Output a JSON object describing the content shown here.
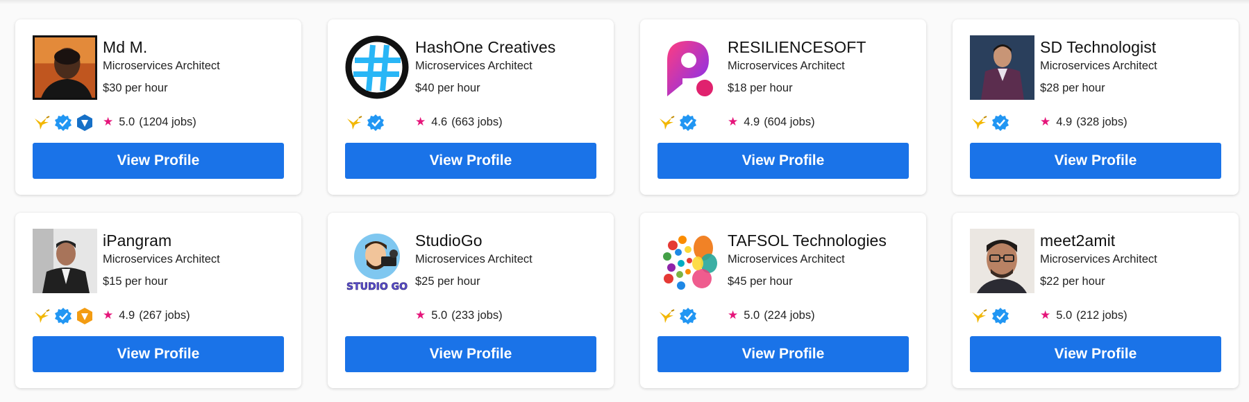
{
  "colors": {
    "accent": "#1a73e8",
    "star": "#e5157a",
    "verified": "#2196f3"
  },
  "cards": [
    {
      "name": "Md M.",
      "role": "Microservices Architect",
      "rate": "$30 per hour",
      "score": "5.0",
      "jobs": "(1204 jobs)",
      "button": "View Profile",
      "badges": [
        "hummingbird-icon",
        "verified-icon",
        "pro-shield-icon"
      ],
      "avatar": "photo-man-dark-shirt"
    },
    {
      "name": "HashOne Creatives",
      "role": "Microservices Architect",
      "rate": "$40 per hour",
      "score": "4.6",
      "jobs": "(663 jobs)",
      "button": "View Profile",
      "badges": [
        "hummingbird-icon",
        "verified-icon"
      ],
      "avatar": "hash-logo"
    },
    {
      "name": "RESILIENCESOFT",
      "role": "Microservices Architect",
      "rate": "$18 per hour",
      "score": "4.9",
      "jobs": "(604 jobs)",
      "button": "View Profile",
      "badges": [
        "hummingbird-icon",
        "verified-icon"
      ],
      "avatar": "r-logo"
    },
    {
      "name": "SD Technologist",
      "role": "Microservices Architect",
      "rate": "$28 per hour",
      "score": "4.9",
      "jobs": "(328 jobs)",
      "button": "View Profile",
      "badges": [
        "hummingbird-icon",
        "verified-icon"
      ],
      "avatar": "photo-man-suit"
    },
    {
      "name": "iPangram",
      "role": "Microservices Architect",
      "rate": "$15 per hour",
      "score": "4.9",
      "jobs": "(267 jobs)",
      "button": "View Profile",
      "badges": [
        "hummingbird-icon",
        "verified-icon",
        "orange-shield-icon"
      ],
      "avatar": "photo-man-blazer"
    },
    {
      "name": "StudioGo",
      "role": "Microservices Architect",
      "rate": "$25 per hour",
      "score": "5.0",
      "jobs": "(233 jobs)",
      "button": "View Profile",
      "badges": [],
      "avatar": "studiogo-logo"
    },
    {
      "name": "TAFSOL Technologies",
      "role": "Microservices Architect",
      "rate": "$45 per hour",
      "score": "5.0",
      "jobs": "(224 jobs)",
      "button": "View Profile",
      "badges": [
        "hummingbird-icon",
        "verified-icon"
      ],
      "avatar": "dots-logo"
    },
    {
      "name": "meet2amit",
      "role": "Microservices Architect",
      "rate": "$22 per hour",
      "score": "5.0",
      "jobs": "(212 jobs)",
      "button": "View Profile",
      "badges": [
        "hummingbird-icon",
        "verified-icon"
      ],
      "avatar": "photo-man-glasses"
    }
  ],
  "logo_text": {
    "studiogo": "STUDIO GO"
  }
}
